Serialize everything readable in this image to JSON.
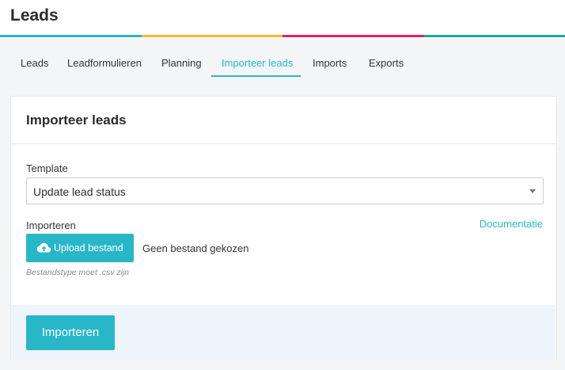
{
  "header": {
    "title": "Leads",
    "stripe_colors": [
      "#29b6c8",
      "#f7b731",
      "#e0245e",
      "#1aab9b"
    ]
  },
  "tabs": [
    {
      "label": "Leads",
      "active": false
    },
    {
      "label": "Leadformulieren",
      "active": false
    },
    {
      "label": "Planning",
      "active": false
    },
    {
      "label": "Importeer leads",
      "active": true
    },
    {
      "label": "Imports",
      "active": false
    },
    {
      "label": "Exports",
      "active": false
    }
  ],
  "card": {
    "title": "Importeer leads",
    "template_label": "Template",
    "template_value": "Update lead status",
    "import_label": "Importeren",
    "documentation_link": "Documentatie",
    "upload_button": "Upload bestand",
    "upload_icon": "cloud-upload-icon",
    "file_status": "Geen bestand gekozen",
    "file_hint": "Bestandstype moet .csv zijn",
    "submit_button": "Importeren"
  },
  "colors": {
    "accent": "#29b6c8",
    "footer_bg": "#eef5fa"
  }
}
